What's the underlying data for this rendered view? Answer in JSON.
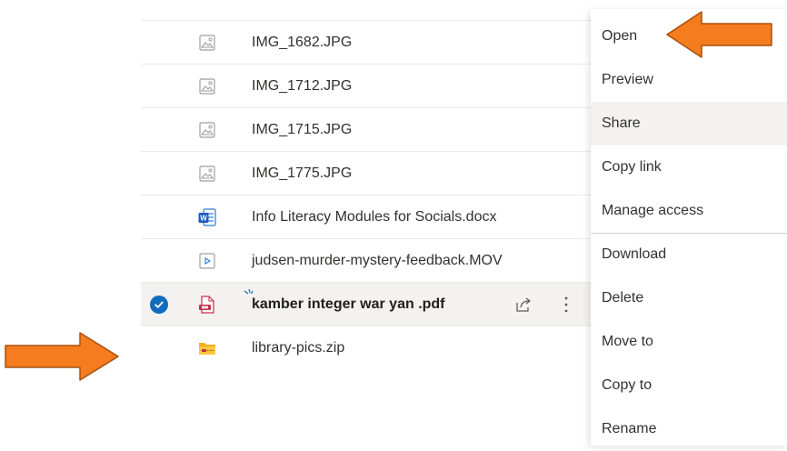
{
  "files": [
    {
      "name": "IMG_1682.JPG",
      "icon": "image-file-icon",
      "selected": false
    },
    {
      "name": "IMG_1712.JPG",
      "icon": "image-file-icon",
      "selected": false
    },
    {
      "name": "IMG_1715.JPG",
      "icon": "image-file-icon",
      "selected": false
    },
    {
      "name": "IMG_1775.JPG",
      "icon": "image-file-icon",
      "selected": false
    },
    {
      "name": "Info Literacy Modules for Socials.docx",
      "icon": "word-doc-icon",
      "selected": false
    },
    {
      "name": "judsen-murder-mystery-feedback.MOV",
      "icon": "video-file-icon",
      "selected": false
    },
    {
      "name": "kamber integer war yan .pdf",
      "icon": "pdf-file-icon",
      "selected": true
    },
    {
      "name": "library-pics.zip",
      "icon": "zip-folder-icon",
      "selected": false
    }
  ],
  "context_menu": {
    "items": [
      "Open",
      "Preview",
      "Share",
      "Copy link",
      "Manage access",
      "Download",
      "Delete",
      "Move to",
      "Copy to",
      "Rename"
    ],
    "highlighted": "Share"
  },
  "colors": {
    "accent": "#0f6cbd",
    "arrow": "#f57c1f",
    "word": "#185abd",
    "pdf": "#c4314b",
    "zip": "#f2b01e"
  }
}
